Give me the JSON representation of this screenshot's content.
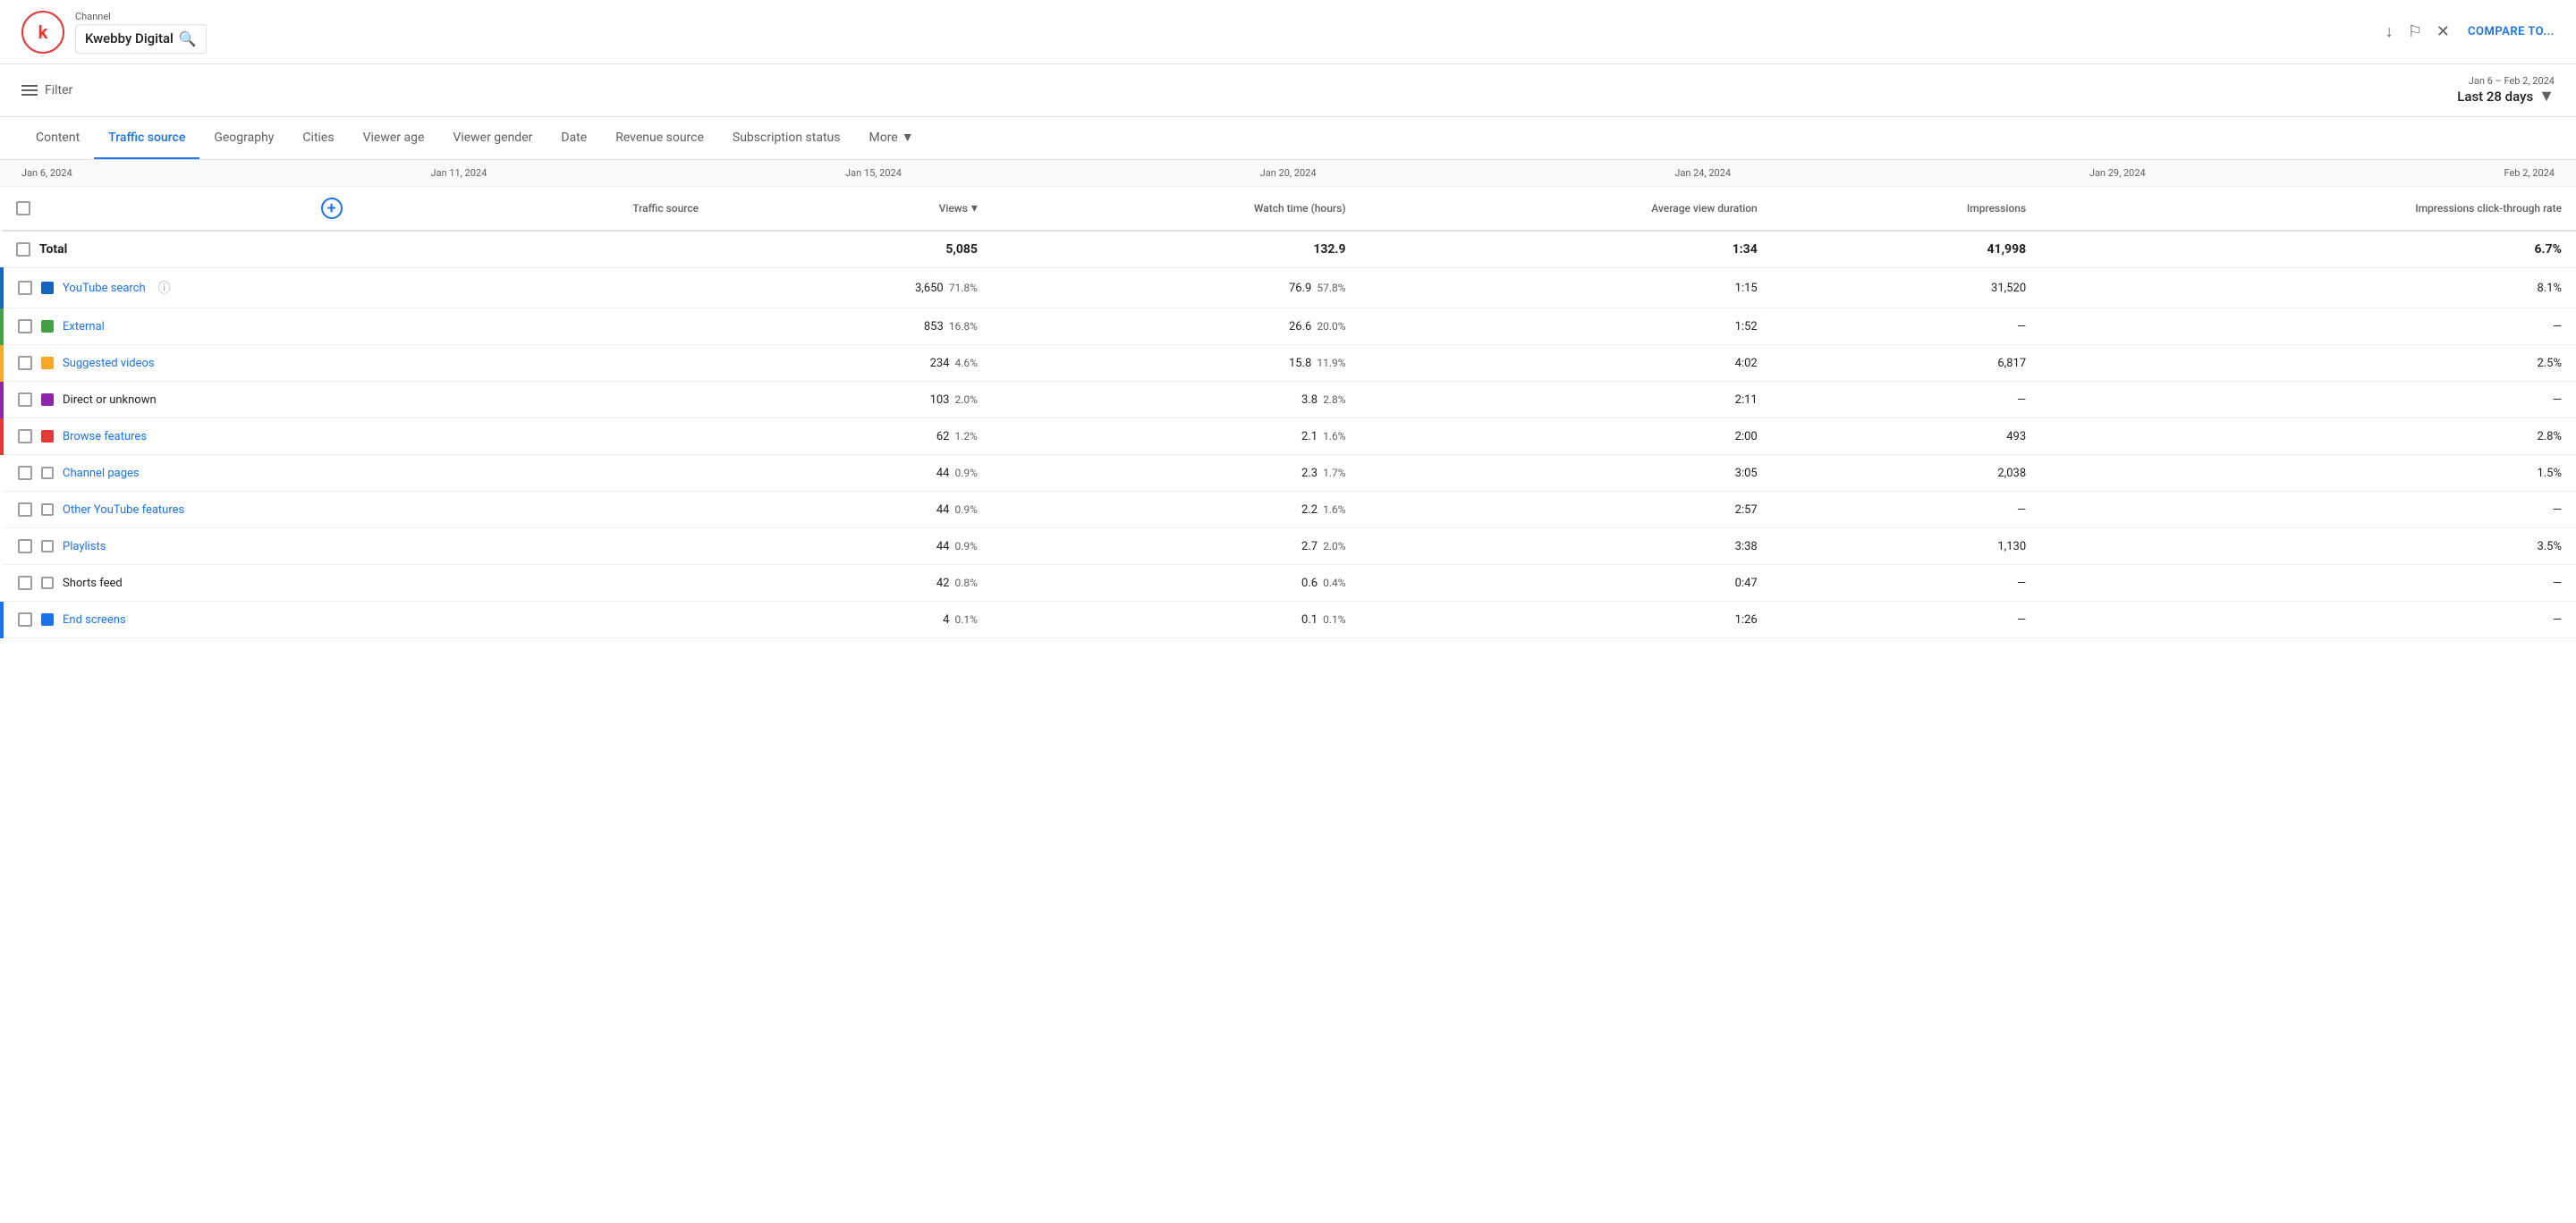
{
  "header": {
    "logo_letter": "k",
    "channel_label": "Channel",
    "channel_name": "Kwebby Digital",
    "compare_label": "COMPARE TO...",
    "icons": [
      "download",
      "flag",
      "close"
    ]
  },
  "filter": {
    "label": "Filter",
    "date_range_small": "Jan 6 – Feb 2, 2024",
    "date_range_main": "Last 28 days"
  },
  "tabs": [
    {
      "label": "Content",
      "active": false
    },
    {
      "label": "Traffic source",
      "active": true
    },
    {
      "label": "Geography",
      "active": false
    },
    {
      "label": "Cities",
      "active": false
    },
    {
      "label": "Viewer age",
      "active": false
    },
    {
      "label": "Viewer gender",
      "active": false
    },
    {
      "label": "Date",
      "active": false
    },
    {
      "label": "Revenue source",
      "active": false
    },
    {
      "label": "Subscription status",
      "active": false
    },
    {
      "label": "More",
      "active": false,
      "has_arrow": true
    }
  ],
  "date_labels": [
    "Jan 6, 2024",
    "Jan 11, 2024",
    "Jan 15, 2024",
    "Jan 20, 2024",
    "Jan 24, 2024",
    "Jan 29, 2024",
    "Feb 2, 2024"
  ],
  "table": {
    "add_column_symbol": "+",
    "columns": [
      {
        "label": "Traffic source",
        "key": "source"
      },
      {
        "label": "Views",
        "key": "views",
        "sortable": true
      },
      {
        "label": "Watch time (hours)",
        "key": "watch_time"
      },
      {
        "label": "Average view duration",
        "key": "avg_duration"
      },
      {
        "label": "Impressions",
        "key": "impressions"
      },
      {
        "label": "Impressions click-through rate",
        "key": "ctr"
      }
    ],
    "total": {
      "label": "Total",
      "views": "5,085",
      "watch_time": "132.9",
      "avg_duration": "1:34",
      "impressions": "41,998",
      "ctr": "6.7%"
    },
    "rows": [
      {
        "color": "#1565c0",
        "dot_style": "square",
        "source": "YouTube search",
        "source_link": true,
        "has_info": true,
        "views": "3,650",
        "views_pct": "71.8%",
        "watch_time": "76.9",
        "watch_time_pct": "57.8%",
        "avg_duration": "1:15",
        "impressions": "31,520",
        "ctr": "8.1%"
      },
      {
        "color": "#43a047",
        "dot_style": "square",
        "source": "External",
        "source_link": true,
        "has_info": false,
        "views": "853",
        "views_pct": "16.8%",
        "watch_time": "26.6",
        "watch_time_pct": "20.0%",
        "avg_duration": "1:52",
        "impressions": "—",
        "ctr": "—"
      },
      {
        "color": "#f9a825",
        "dot_style": "square",
        "source": "Suggested videos",
        "source_link": true,
        "has_info": false,
        "views": "234",
        "views_pct": "4.6%",
        "watch_time": "15.8",
        "watch_time_pct": "11.9%",
        "avg_duration": "4:02",
        "impressions": "6,817",
        "ctr": "2.5%"
      },
      {
        "color": "#8e24aa",
        "dot_style": "square",
        "source": "Direct or unknown",
        "source_link": false,
        "has_info": false,
        "views": "103",
        "views_pct": "2.0%",
        "watch_time": "3.8",
        "watch_time_pct": "2.8%",
        "avg_duration": "2:11",
        "impressions": "—",
        "ctr": "—"
      },
      {
        "color": "#e53935",
        "dot_style": "square",
        "source": "Browse features",
        "source_link": true,
        "has_info": false,
        "views": "62",
        "views_pct": "1.2%",
        "watch_time": "2.1",
        "watch_time_pct": "1.6%",
        "avg_duration": "2:00",
        "impressions": "493",
        "ctr": "2.8%"
      },
      {
        "color": null,
        "dot_style": "square",
        "source": "Channel pages",
        "source_link": true,
        "has_info": false,
        "views": "44",
        "views_pct": "0.9%",
        "watch_time": "2.3",
        "watch_time_pct": "1.7%",
        "avg_duration": "3:05",
        "impressions": "2,038",
        "ctr": "1.5%"
      },
      {
        "color": null,
        "dot_style": "square",
        "source": "Other YouTube features",
        "source_link": true,
        "has_info": false,
        "views": "44",
        "views_pct": "0.9%",
        "watch_time": "2.2",
        "watch_time_pct": "1.6%",
        "avg_duration": "2:57",
        "impressions": "—",
        "ctr": "—"
      },
      {
        "color": null,
        "dot_style": "square",
        "source": "Playlists",
        "source_link": true,
        "has_info": false,
        "views": "44",
        "views_pct": "0.9%",
        "watch_time": "2.7",
        "watch_time_pct": "2.0%",
        "avg_duration": "3:38",
        "impressions": "1,130",
        "ctr": "3.5%"
      },
      {
        "color": null,
        "dot_style": "square",
        "source": "Shorts feed",
        "source_link": false,
        "has_info": false,
        "views": "42",
        "views_pct": "0.8%",
        "watch_time": "0.6",
        "watch_time_pct": "0.4%",
        "avg_duration": "0:47",
        "impressions": "—",
        "ctr": "—"
      },
      {
        "color": "#1a73e8",
        "dot_style": "square",
        "source": "End screens",
        "source_link": true,
        "has_info": false,
        "views": "4",
        "views_pct": "0.1%",
        "watch_time": "0.1",
        "watch_time_pct": "0.1%",
        "avg_duration": "1:26",
        "impressions": "—",
        "ctr": "—"
      }
    ]
  }
}
